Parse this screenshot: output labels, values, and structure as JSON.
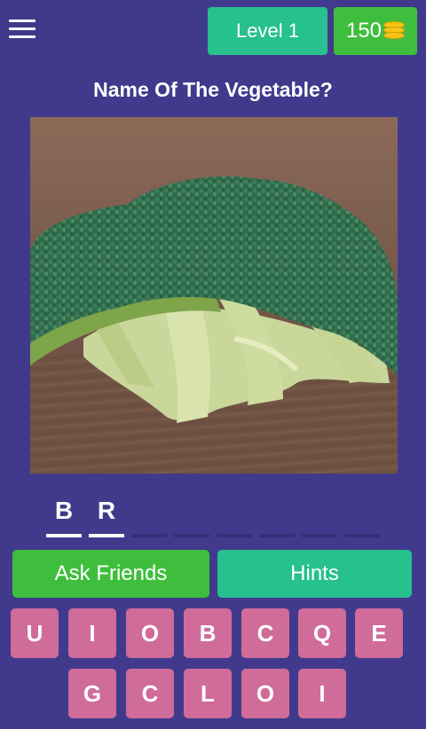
{
  "header": {
    "level_label": "Level 1",
    "coins": "150"
  },
  "question": "Name Of The Vegetable?",
  "answer": [
    "B",
    "R",
    "",
    "",
    "",
    "",
    "",
    ""
  ],
  "buttons": {
    "ask_friends": "Ask Friends",
    "hints": "Hints"
  },
  "letters": {
    "row1": [
      "U",
      "I",
      "O",
      "B",
      "C",
      "Q",
      "E"
    ],
    "row2": [
      "G",
      "C",
      "L",
      "O",
      "I"
    ]
  },
  "colors": {
    "background": "#413a8c",
    "green": "#3fbe3d",
    "teal": "#27c08f",
    "tile_pink": "#d06c9a"
  }
}
